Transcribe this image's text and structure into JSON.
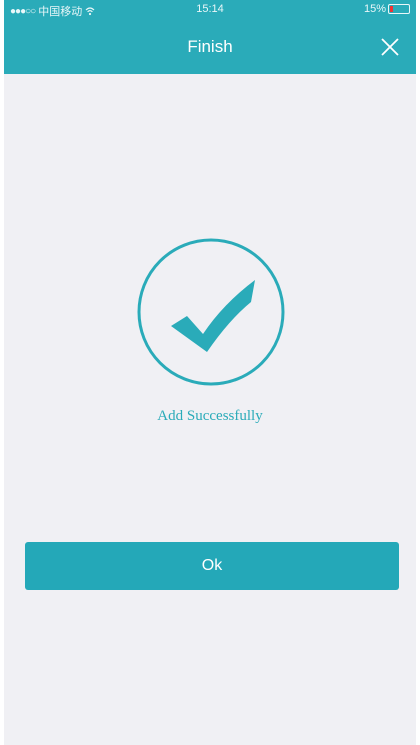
{
  "status_bar": {
    "carrier": "中国移动",
    "time": "15:14",
    "battery": "15%"
  },
  "nav": {
    "title": "Finish",
    "close_icon": "close-icon"
  },
  "content": {
    "message": "Add Successfully",
    "icon": "checkmark-circle-icon"
  },
  "actions": {
    "ok_label": "Ok"
  },
  "colors": {
    "accent": "#2aabb9",
    "background": "#f0f0f4"
  }
}
